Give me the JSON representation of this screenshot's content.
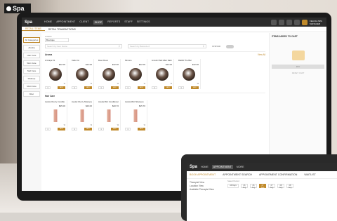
{
  "brand": {
    "name": "Spa"
  },
  "main": {
    "topbar": {
      "brand": "Spa",
      "nav": [
        "HOME",
        "APPOINTMENT",
        "CLIENT",
        "SHOP",
        "REPORTS",
        "STAFF",
        "SETTINGS"
      ],
      "active_nav": 3,
      "user": "FELICIA\nSPA MANAGER"
    },
    "subtabs": [
      "RETAIL ITEMS",
      "RETAIL TRANSACTIONS"
    ],
    "left_categories": [
      "All Categories",
      "Alcoba",
      "Hair Care",
      "Skin Care",
      "Nail Care",
      "Makeup",
      "Multi Care",
      "Misc"
    ],
    "location_label": "Location",
    "location_value": "Boutique",
    "search_name_placeholder": "Search by Item Name",
    "search_barcode_placeholder": "Search by Barcode #",
    "toggle_label": "IN STOCK",
    "section1": {
      "title": "Aroma",
      "more": "View All"
    },
    "section1_products": [
      {
        "name": "A Grape Fit",
        "price": "$12.00",
        "pct": "%",
        "qty": "1",
        "add": "ADD"
      },
      {
        "name": "Cabo Co",
        "price": "$12.00",
        "pct": "%",
        "qty": "1",
        "add": "ADD"
      },
      {
        "name": "Deux Deux",
        "price": "$12.00",
        "pct": "%",
        "qty": "1",
        "add": "ADD"
      },
      {
        "name": "Kimono",
        "price": "$12.00",
        "pct": "%",
        "qty": "1",
        "add": "ADD"
      },
      {
        "name": "Lincoln Park After Dark",
        "price": "$12.00",
        "pct": "%",
        "qty": "1",
        "add": "ADD"
      },
      {
        "name": "Rabbit The Bar",
        "price": "$12.00",
        "pct": "%",
        "qty": "1",
        "add": "ADD"
      }
    ],
    "section2": {
      "title": "Hair Care"
    },
    "section2_products": [
      {
        "name": "Aveda Cherry Conditio...",
        "price": "$25.00",
        "pct": "%",
        "qty": "1",
        "add": "ADD"
      },
      {
        "name": "Aveda Cherry Shampoo",
        "price": "$20.00",
        "pct": "%",
        "qty": "1",
        "add": "ADD"
      },
      {
        "name": "Aveda Mint Conditioner",
        "price": "$20.70",
        "pct": "%",
        "qty": "1",
        "add": "ADD"
      },
      {
        "name": "Aveda Mint Shampoo",
        "price": "$15.70",
        "pct": "%",
        "qty": "1",
        "add": "ADD"
      }
    ],
    "cart": {
      "title": "ITEMS ADDED TO CART",
      "pay": "PAY",
      "reset": "RESET CART"
    }
  },
  "laptop": {
    "brand": "Spa",
    "nav": [
      "HOME",
      "APPOINTMENT",
      "MORE"
    ],
    "active_nav": 1,
    "tabs": [
      "BOOK APPOINTMENT",
      "APPOINTMENT SEARCH",
      "APPOINTMENT CONFIRMATION",
      "WAITLIST"
    ],
    "left": [
      "Therapist View",
      "Location View",
      "Available Therapist View"
    ],
    "select_label": "Select Period",
    "all_days": "All Days",
    "day_buttons": [
      "26 Aug",
      "26 Aug",
      "27 Aug",
      "27 Aug",
      "28 Aug",
      "28 Aug"
    ]
  }
}
